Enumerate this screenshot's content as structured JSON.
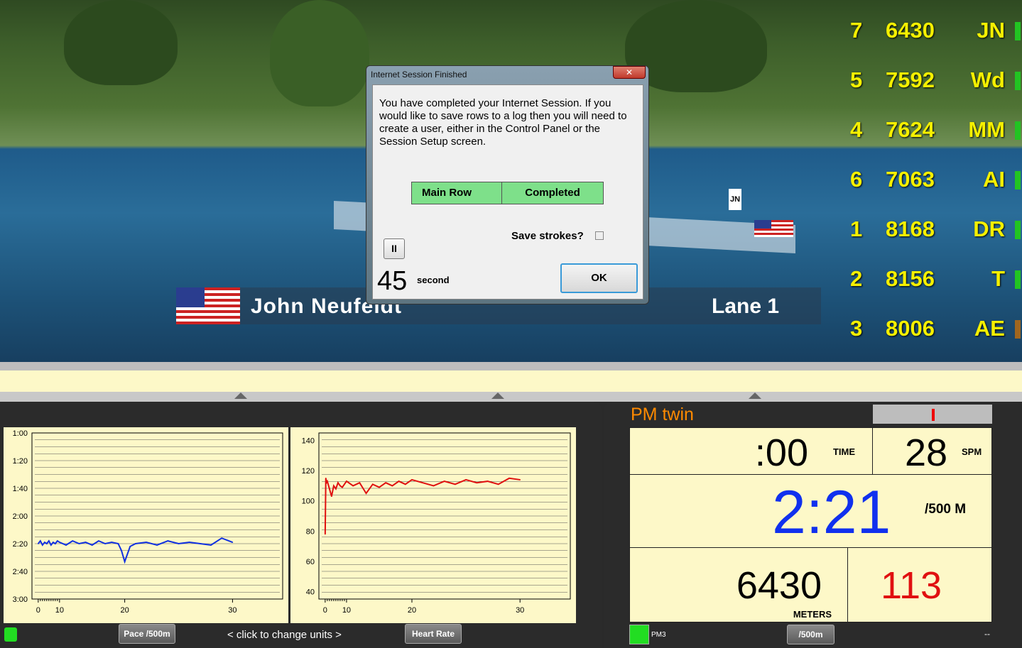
{
  "leaderboard": [
    {
      "lane": "7",
      "meters": "6430",
      "initials": "JN",
      "color": "#22c422"
    },
    {
      "lane": "5",
      "meters": "7592",
      "initials": "Wd",
      "color": "#22c422"
    },
    {
      "lane": "4",
      "meters": "7624",
      "initials": "MM",
      "color": "#22c422"
    },
    {
      "lane": "6",
      "meters": "7063",
      "initials": "AI",
      "color": "#22c422"
    },
    {
      "lane": "1",
      "meters": "8168",
      "initials": "DR",
      "color": "#22c422"
    },
    {
      "lane": "2",
      "meters": "8156",
      "initials": "T",
      "color": "#22c422"
    },
    {
      "lane": "3",
      "meters": "8006",
      "initials": "AE",
      "color": "#a0661e"
    }
  ],
  "boat_tag": "JN",
  "rower": {
    "name": "John Neufeldt",
    "lane": "Lane  1",
    "flag": "us-flag-icon"
  },
  "dialog": {
    "title": "Internet Session Finished",
    "close": "✕",
    "message": "You have completed your Internet Session.  If you would like to save rows to a log then you will need to create a user, either in the Control Panel or the Session Setup screen.",
    "status_cells": [
      "Main Row",
      "Completed"
    ],
    "status_color": "#7ee08a",
    "save_strokes_label": "Save strokes?",
    "save_strokes_checked": false,
    "countdown": "45",
    "countdown_unit": "second",
    "ok": "OK",
    "pause": "II"
  },
  "charts": [
    {
      "type": "line",
      "color": "#1030e0",
      "yticks": [
        "1:00",
        "1:20",
        "1:40",
        "2:00",
        "2:20",
        "2:40",
        "3:00"
      ],
      "ylim": [
        60,
        180
      ],
      "yreversed": true,
      "xticks": [
        "0",
        "10",
        "20",
        "30"
      ],
      "x": [
        0,
        1,
        2,
        3,
        4,
        5,
        6,
        7,
        8,
        9,
        10,
        11,
        12,
        13,
        14,
        15,
        16,
        17,
        18,
        19,
        19.5,
        20,
        20.5,
        21,
        22,
        23,
        24,
        25,
        26,
        27,
        28,
        29,
        30
      ],
      "values": [
        140,
        138,
        141,
        139,
        140,
        138,
        141,
        139,
        140,
        138,
        139,
        141,
        138,
        140,
        139,
        141,
        138,
        140,
        139,
        140,
        145,
        153,
        142,
        140,
        139,
        141,
        138,
        140,
        139,
        140,
        141,
        136,
        139
      ]
    },
    {
      "type": "line",
      "color": "#e01010",
      "yticks": [
        "40",
        "60",
        "80",
        "100",
        "120",
        "140"
      ],
      "ylim": [
        35,
        145
      ],
      "xticks": [
        "0",
        "10",
        "20",
        "30"
      ],
      "x": [
        0,
        0.3,
        0.6,
        1,
        2,
        3,
        4,
        5,
        6,
        7,
        8,
        9,
        10,
        11,
        12,
        13,
        14,
        15,
        16,
        17,
        18,
        19,
        20,
        21,
        22,
        23,
        24,
        25,
        26,
        27,
        28,
        29,
        30
      ],
      "values": [
        78,
        115,
        112,
        113,
        108,
        103,
        110,
        108,
        112,
        110,
        109,
        111,
        113,
        110,
        112,
        105,
        111,
        109,
        112,
        110,
        113,
        111,
        114,
        112,
        110,
        113,
        111,
        114,
        112,
        113,
        111,
        115,
        114
      ]
    }
  ],
  "left_footer": {
    "pace_button": "Pace /500m",
    "hint": "<  click to change units  >",
    "hr_button": "Heart Rate"
  },
  "monitor": {
    "title": "PM twin",
    "time": ":00",
    "time_label": "TIME",
    "spm": "28",
    "spm_label": "SPM",
    "pace": "2:21",
    "pace_unit": "/500 M",
    "meters": "6430",
    "meters_label": "METERS",
    "heart_rate": "113",
    "device": "PM3",
    "units_button": "/500m",
    "status": "--",
    "status_color": "#22dd22"
  }
}
